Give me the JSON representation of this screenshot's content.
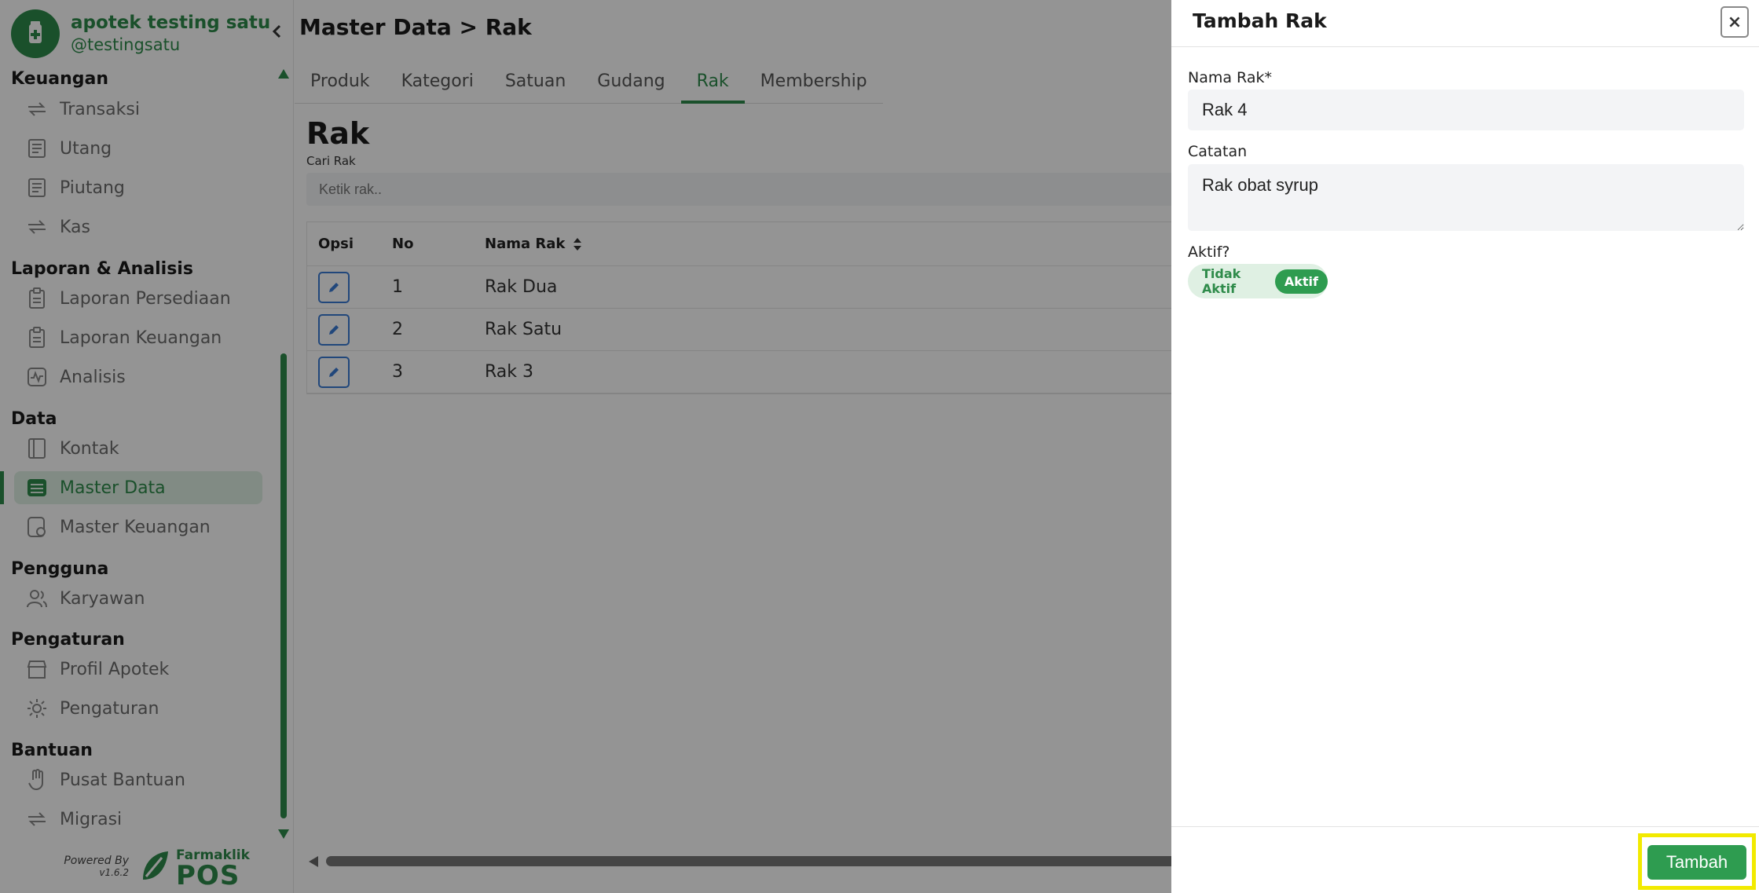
{
  "brand": {
    "name": "apotek testing satu",
    "handle": "@testingsatu"
  },
  "colors": {
    "primary": "#2e8b4a",
    "edit_border": "#3a7bd5",
    "highlight": "#f2ea00"
  },
  "sidebar": {
    "sections": [
      {
        "title": "Keuangan",
        "items": [
          {
            "label": "Transaksi",
            "icon": "transaction-icon"
          },
          {
            "label": "Utang",
            "icon": "ledger-icon"
          },
          {
            "label": "Piutang",
            "icon": "ledger-icon"
          },
          {
            "label": "Kas",
            "icon": "cash-icon"
          }
        ]
      },
      {
        "title": "Laporan & Analisis",
        "items": [
          {
            "label": "Laporan Persediaan",
            "icon": "clipboard-icon"
          },
          {
            "label": "Laporan Keuangan",
            "icon": "clipboard-icon"
          },
          {
            "label": "Analisis",
            "icon": "analytics-icon"
          }
        ]
      },
      {
        "title": "Data",
        "items": [
          {
            "label": "Kontak",
            "icon": "contact-book-icon"
          },
          {
            "label": "Master Data",
            "icon": "database-icon",
            "active": true
          },
          {
            "label": "Master Keuangan",
            "icon": "finance-icon"
          }
        ]
      },
      {
        "title": "Pengguna",
        "items": [
          {
            "label": "Karyawan",
            "icon": "users-icon"
          }
        ]
      },
      {
        "title": "Pengaturan",
        "items": [
          {
            "label": "Profil Apotek",
            "icon": "store-icon"
          },
          {
            "label": "Pengaturan",
            "icon": "gear-icon"
          }
        ]
      },
      {
        "title": "Bantuan",
        "items": [
          {
            "label": "Pusat Bantuan",
            "icon": "hand-icon"
          },
          {
            "label": "Migrasi",
            "icon": "migrate-icon"
          }
        ]
      }
    ],
    "powered_by": "Powered By",
    "version": "v1.6.2",
    "product_small": "Farmaklik",
    "product_big": "POS"
  },
  "main": {
    "title": "Master Data > Rak",
    "tabs": [
      {
        "label": "Produk"
      },
      {
        "label": "Kategori"
      },
      {
        "label": "Satuan"
      },
      {
        "label": "Gudang"
      },
      {
        "label": "Rak",
        "active": true
      },
      {
        "label": "Membership"
      }
    ],
    "section_heading": "Rak",
    "search_label": "Cari Rak",
    "search_placeholder": "Ketik rak..",
    "table": {
      "headers": {
        "opsi": "Opsi",
        "no": "No",
        "nama": "Nama Rak"
      },
      "rows": [
        {
          "no": "1",
          "nama": "Rak Dua"
        },
        {
          "no": "2",
          "nama": "Rak Satu"
        },
        {
          "no": "3",
          "nama": "Rak 3"
        }
      ]
    }
  },
  "drawer": {
    "title": "Tambah Rak",
    "close": "×",
    "nama_label": "Nama Rak*",
    "nama_value": "Rak 4",
    "catatan_label": "Catatan",
    "catatan_value": "Rak obat syrup",
    "aktif_label": "Aktif?",
    "toggle_off": "Tidak Aktif",
    "toggle_on": "Aktif",
    "submit": "Tambah"
  }
}
